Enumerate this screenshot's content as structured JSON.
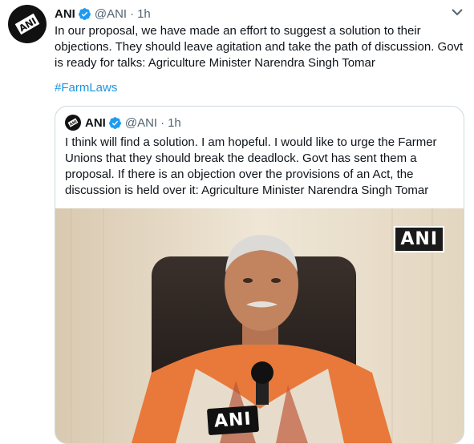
{
  "tweet": {
    "name": "ANI",
    "handle": "@ANI",
    "separator": "·",
    "time": "1h",
    "text": "In our proposal, we have made an effort to suggest a solution to their objections. They should leave agitation and take the path of discussion. Govt is ready for talks: Agriculture Minister Narendra Singh Tomar",
    "hashtag": "#FarmLaws"
  },
  "quoted": {
    "name": "ANI",
    "handle": "@ANI",
    "separator": "·",
    "time": "1h",
    "text": "I think will find a solution. I am hopeful. I would like to urge the Farmer Unions that they should break the deadlock. Govt has sent them a proposal. If there is an objection over the provisions of an Act, the discussion is held over it: Agriculture Minister Narendra Singh Tomar",
    "media": {
      "watermark": "ANI",
      "mic_label": "ANI"
    }
  },
  "colors": {
    "link": "#1b95e0",
    "verified": "#1d9bf0",
    "secondary_text": "#536471"
  },
  "icons": [
    "ani-logo-icon",
    "verified-badge-icon",
    "caret-down-icon"
  ]
}
